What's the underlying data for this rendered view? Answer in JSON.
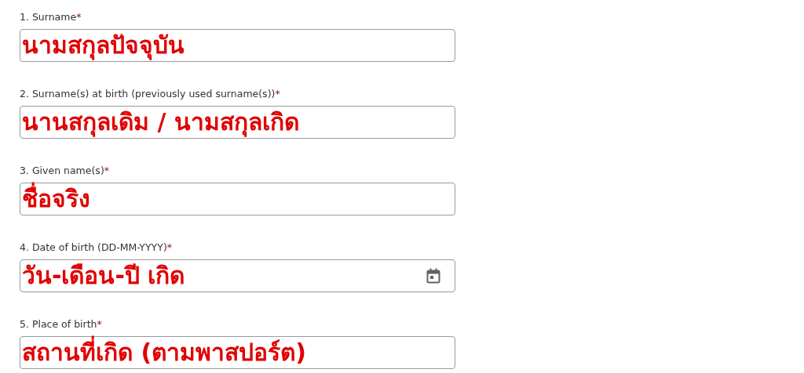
{
  "fields": [
    {
      "label": "1. Surname",
      "required_mark": "*",
      "kind": "text",
      "value": "นามสกุลปัจจุบัน"
    },
    {
      "label": "2. Surname(s) at birth (previously used surname(s))",
      "required_mark": "*",
      "kind": "text",
      "value": "นานสกุลเดิม / นามสกุลเกิด"
    },
    {
      "label": "3. Given name(s)",
      "required_mark": "*",
      "kind": "text",
      "value": "ชื่อจริง"
    },
    {
      "label": "4. Date of birth (DD-MM-YYYY)",
      "required_mark": "*",
      "kind": "date",
      "value": "วัน-เดือน-ปี เกิด"
    },
    {
      "label": "5. Place of birth",
      "required_mark": "*",
      "kind": "text",
      "value": "สถานที่เกิด (ตามพาสปอร์ต)"
    }
  ]
}
